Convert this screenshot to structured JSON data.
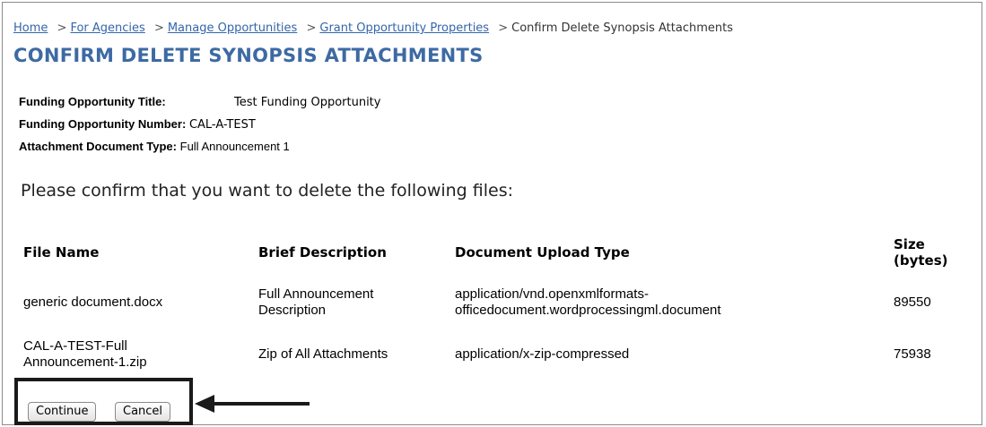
{
  "breadcrumb": {
    "home": "Home",
    "for_agencies": "For Agencies",
    "manage_opportunities": "Manage Opportunities",
    "grant_properties": "Grant Opportunity Properties",
    "current": "Confirm Delete Synopsis Attachments",
    "separator": ">"
  },
  "page_title": "CONFIRM DELETE SYNOPSIS ATTACHMENTS",
  "details": {
    "title_label": "Funding Opportunity Title:",
    "title_value": "Test Funding Opportunity",
    "number_label": "Funding Opportunity Number:",
    "number_value": "CAL-A-TEST",
    "doctype_label": "Attachment Document Type:",
    "doctype_value": "Full Announcement 1"
  },
  "prompt": "Please confirm that you want to delete the following files:",
  "table": {
    "headers": {
      "file_name": "File Name",
      "description": "Brief Description",
      "upload_type": "Document Upload Type",
      "size_line1": "Size",
      "size_line2": "(bytes)"
    },
    "rows": [
      {
        "file_name": [
          "generic document.docx"
        ],
        "description": [
          "Full Announcement",
          "Description"
        ],
        "upload_type": [
          "application/vnd.openxmlformats-",
          "officedocument.wordprocessingml.document"
        ],
        "size": "89550"
      },
      {
        "file_name": [
          "CAL-A-TEST-Full",
          "Announcement-1.zip"
        ],
        "description": [
          "Zip of All Attachments"
        ],
        "upload_type": [
          "application/x-zip-compressed"
        ],
        "size": "75938"
      }
    ]
  },
  "buttons": {
    "continue": "Continue",
    "cancel": "Cancel"
  },
  "colors": {
    "title": "#3d6aa3",
    "link": "#3366aa",
    "highlight_box": "#1a1a1a"
  }
}
